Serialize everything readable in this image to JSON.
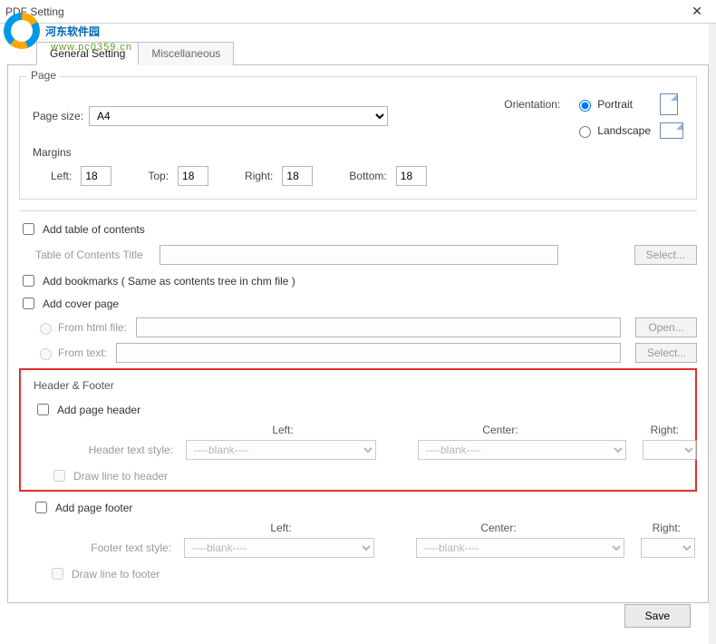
{
  "window": {
    "title": "PDF Setting",
    "close": "✕"
  },
  "watermark": {
    "text": "河东软件园",
    "sub": "www.pc0359.cn"
  },
  "tabs": {
    "general": "General Setting",
    "misc": "Miscellaneous"
  },
  "page": {
    "legend": "Page",
    "sizeLabel": "Page size:",
    "sizeValue": "A4",
    "orientationLabel": "Orientation:",
    "portrait": "Portrait",
    "landscape": "Landscape",
    "marginsLabel": "Margins",
    "left": "Left:",
    "leftVal": "18",
    "top": "Top:",
    "topVal": "18",
    "right": "Right:",
    "rightVal": "18",
    "bottom": "Bottom:",
    "bottomVal": "18"
  },
  "toc": {
    "addToc": "Add table of contents",
    "titleLabel": "Table of Contents Title",
    "titleVal": "",
    "selectBtn": "Select...",
    "addBookmarks": "Add  bookmarks ( Same as contents tree in chm file )",
    "addCover": "Add cover page",
    "fromHtml": "From html file:",
    "fromText": "From  text:",
    "openBtn": "Open...",
    "selectBtn2": "Select..."
  },
  "hf": {
    "legend": "Header & Footer",
    "addHeader": "Add page header",
    "leftCol": "Left:",
    "centerCol": "Center:",
    "rightCol": "Right:",
    "headerStyleLabel": "Header text style:",
    "blank": "----blank----",
    "drawLineHeader": "Draw line to header",
    "addFooter": "Add page footer",
    "footerStyleLabel": "Footer text style:",
    "drawLineFooter": "Draw line to footer"
  },
  "save": "Save"
}
